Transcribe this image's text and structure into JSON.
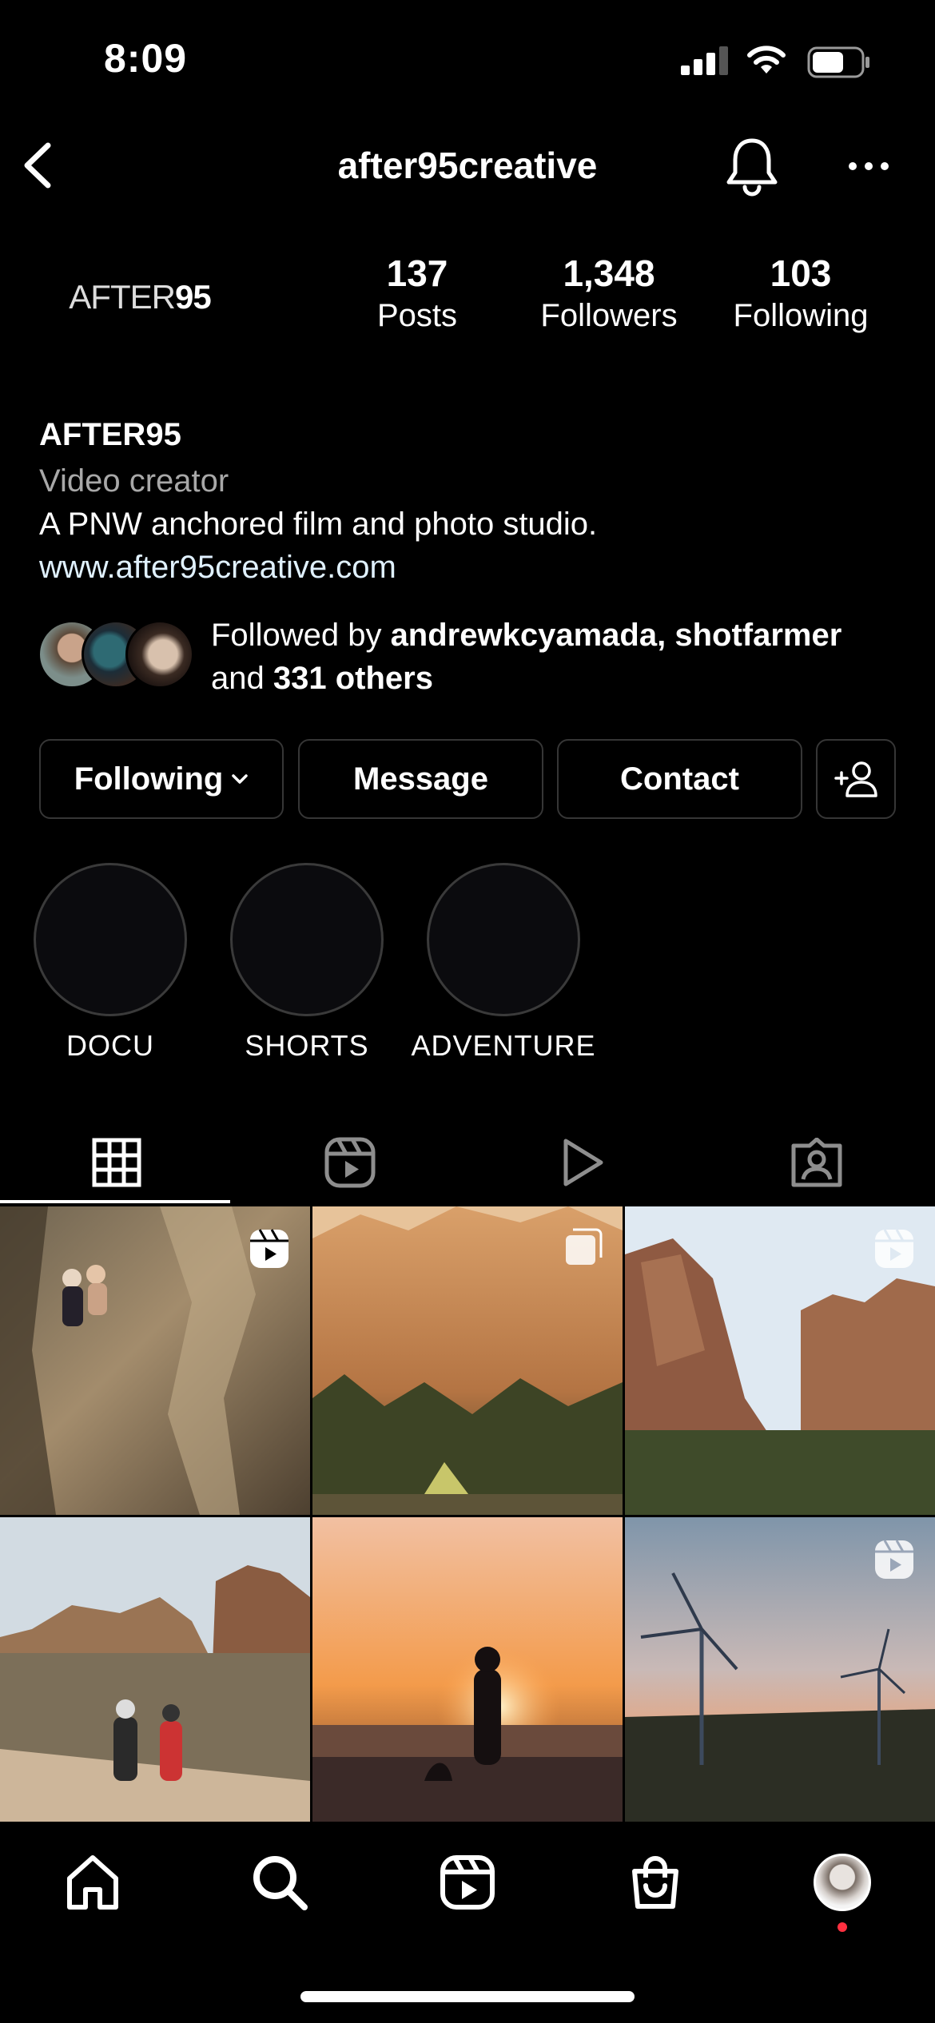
{
  "status_bar": {
    "time": "8:09"
  },
  "header": {
    "username": "after95creative"
  },
  "profile": {
    "logo": {
      "light": "AFTER",
      "bold": "95"
    },
    "stats": [
      {
        "value": "137",
        "label": "Posts"
      },
      {
        "value": "1,348",
        "label": "Followers"
      },
      {
        "value": "103",
        "label": "Following"
      }
    ],
    "name": "AFTER95",
    "category": "Video creator",
    "bio": "A PNW anchored film and photo studio.",
    "website": "www.after95creative.com",
    "followed_by": {
      "prefix": "Followed by",
      "user1": "andrewkcyamada",
      "user2": "shotfarmer",
      "joiner": "and",
      "others": "331 others"
    }
  },
  "actions": {
    "following": "Following",
    "message": "Message",
    "contact": "Contact"
  },
  "highlights": [
    {
      "label": "DOCU"
    },
    {
      "label": "SHORTS"
    },
    {
      "label": "ADVENTURE"
    }
  ],
  "tabs": [
    "grid-icon",
    "reels-icon",
    "play-icon",
    "tagged-icon"
  ],
  "grid_badges": [
    "reel-badge",
    "multi-badge",
    "reel-badge",
    "",
    "",
    "reel-badge"
  ],
  "colors": {
    "background": "#000000",
    "border": "#363636",
    "notification_dot": "#ff3040"
  }
}
